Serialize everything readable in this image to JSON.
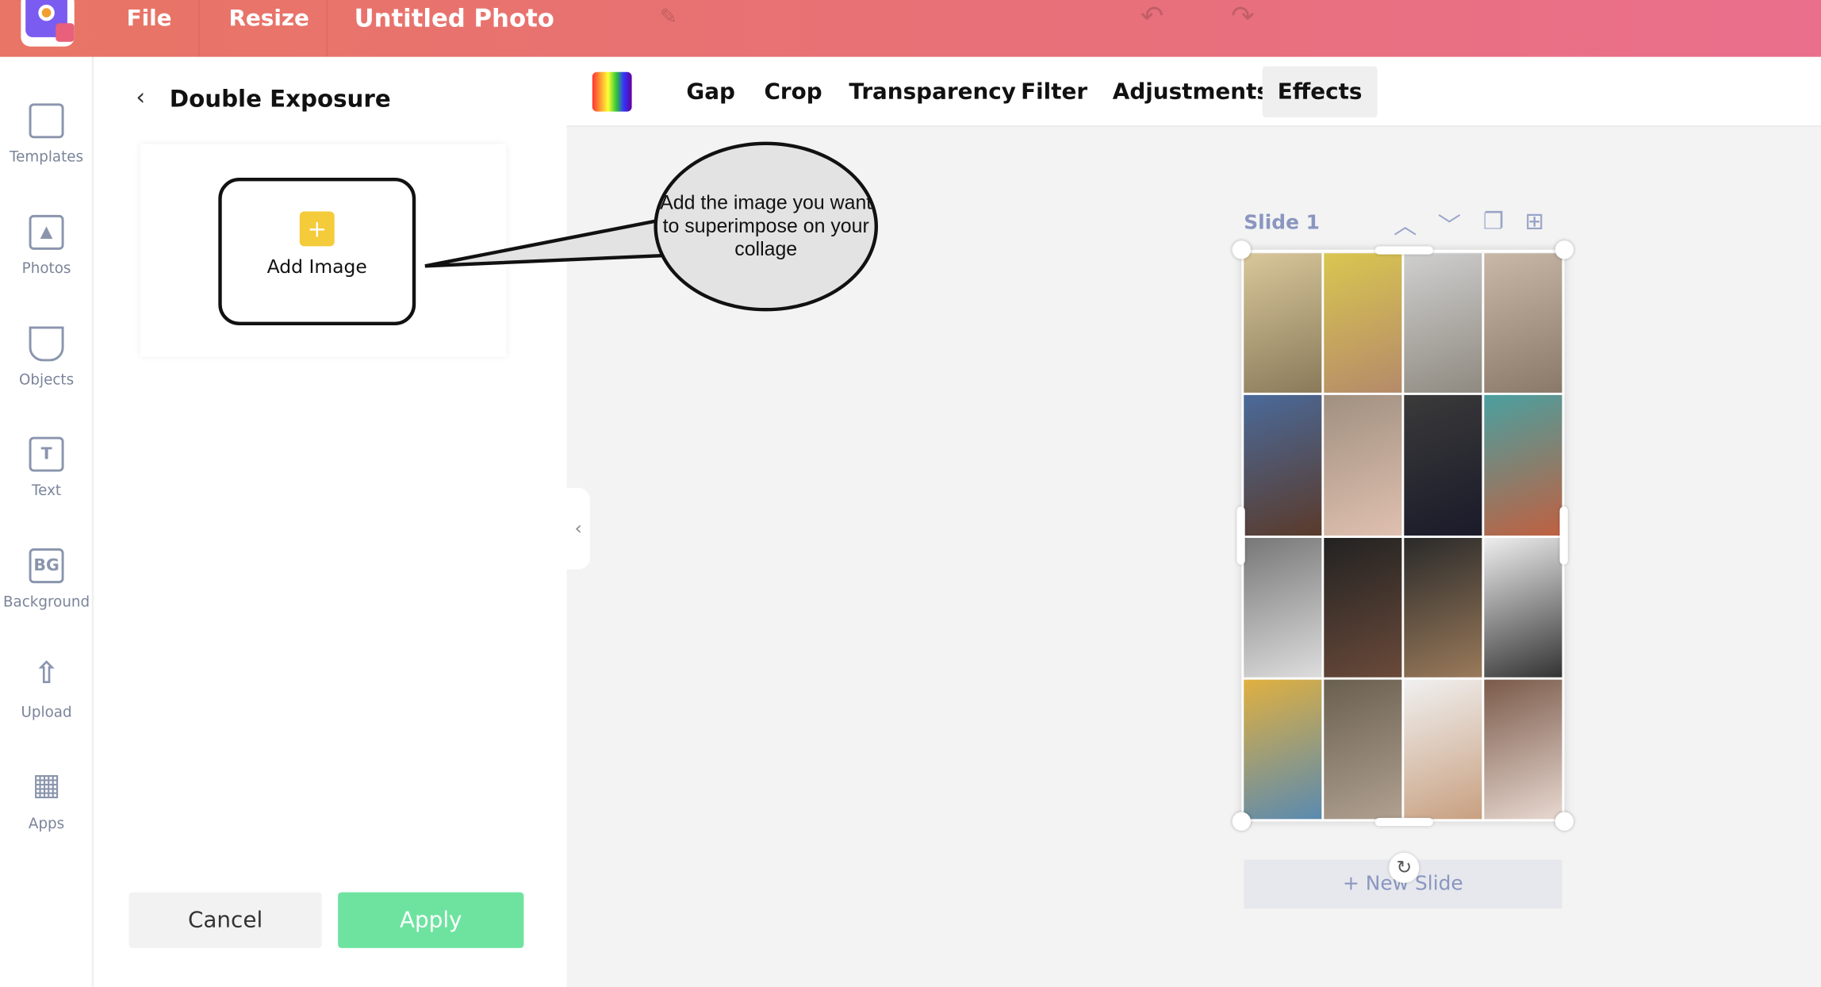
{
  "topbar": {
    "menu": [
      "File",
      "Resize"
    ],
    "title": "Untitled Photo",
    "icons": [
      "pencil-icon",
      "undo-icon",
      "redo-icon"
    ]
  },
  "sidebar": {
    "items": [
      {
        "label": "Templates",
        "icon": "templates-icon"
      },
      {
        "label": "Photos",
        "icon": "photos-icon"
      },
      {
        "label": "Objects",
        "icon": "objects-icon"
      },
      {
        "label": "Text",
        "icon": "text-icon",
        "glyph": "T"
      },
      {
        "label": "Background",
        "icon": "background-icon",
        "glyph": "BG"
      },
      {
        "label": "Upload",
        "icon": "upload-icon"
      },
      {
        "label": "Apps",
        "icon": "apps-icon"
      }
    ]
  },
  "panel": {
    "title": "Double Exposure",
    "add_image": "Add Image",
    "cancel": "Cancel",
    "apply": "Apply"
  },
  "toolbar": {
    "tabs": [
      "Gap",
      "Crop",
      "Transparency",
      "Filter",
      "Adjustments",
      "Effects"
    ],
    "active": "Effects"
  },
  "callout": {
    "text": "Add the image you want to superimpose on your collage"
  },
  "canvas": {
    "slide_label": "Slide 1",
    "new_slide": "+ New Slide"
  },
  "colors": {
    "accent": "#e8707a",
    "apply": "#6ee3a0",
    "slide": "#8a96c0"
  }
}
